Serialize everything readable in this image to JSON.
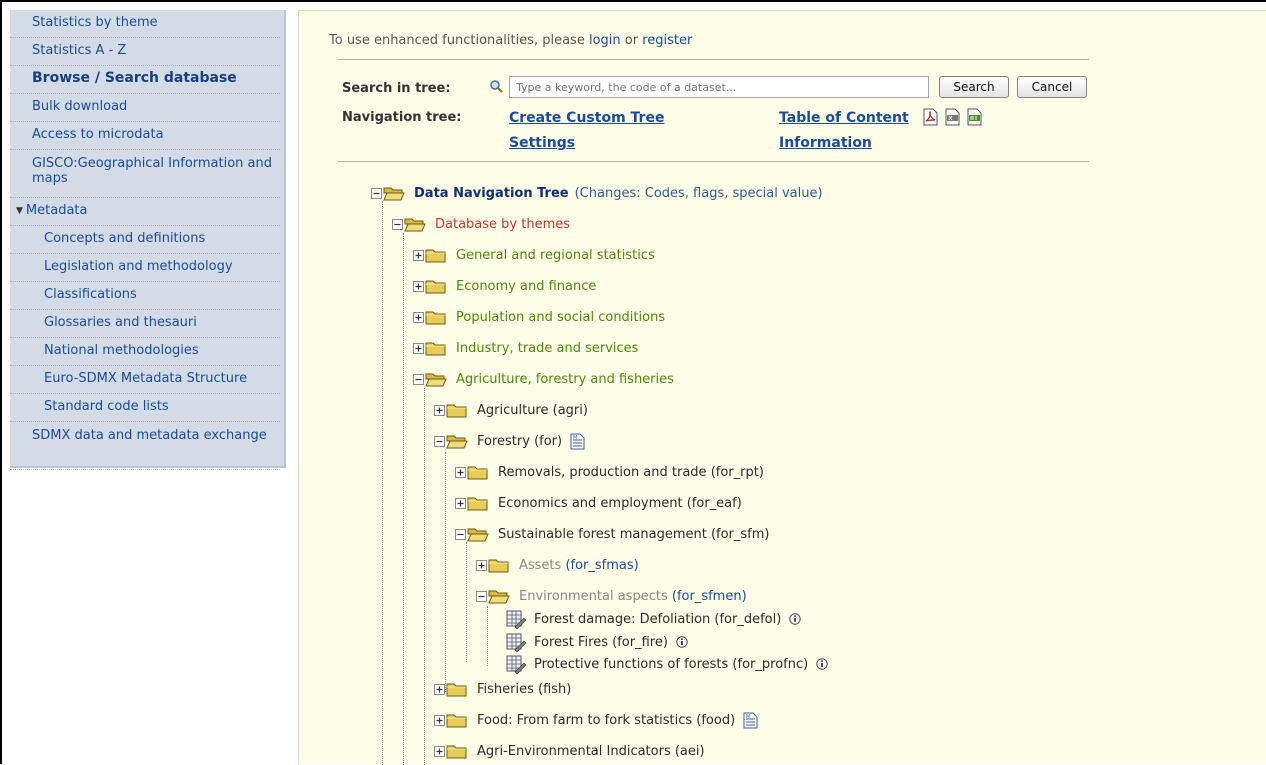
{
  "sidebar": {
    "items": [
      {
        "label": "Statistics by theme"
      },
      {
        "label": "Statistics A - Z"
      },
      {
        "label": "Browse / Search database"
      },
      {
        "label": "Bulk download"
      },
      {
        "label": "Access to microdata"
      },
      {
        "label": "GISCO:Geographical Information and maps"
      },
      {
        "label": "Metadata"
      },
      {
        "label": "Concepts and definitions"
      },
      {
        "label": "Legislation and methodology"
      },
      {
        "label": "Classifications"
      },
      {
        "label": "Glossaries and thesauri"
      },
      {
        "label": "National methodologies"
      },
      {
        "label": "Euro-SDMX Metadata Structure"
      },
      {
        "label": "Standard code lists"
      },
      {
        "label": "SDMX data and metadata exchange"
      }
    ]
  },
  "notice": {
    "prefix": "To use enhanced functionalities, please ",
    "login": "login",
    "middle": " or ",
    "register": "register"
  },
  "search": {
    "label": "Search in tree:",
    "placeholder": "Type a keyword, the code of a dataset...",
    "search_button": "Search",
    "cancel_button": "Cancel"
  },
  "navigation": {
    "label": "Navigation tree:",
    "create_custom_tree": "Create Custom Tree",
    "settings": "Settings",
    "table_of_content": "Table of Content",
    "information": "Information"
  },
  "export_icons": [
    "pdf-icon",
    "xls-icon",
    "xml-icon"
  ],
  "tree": {
    "root": {
      "title": "Data Navigation Tree",
      "note": "(Changes: Codes, flags, special value)"
    },
    "database_by_themes": "Database by themes",
    "themes": [
      "General and regional statistics",
      "Economy and finance",
      "Population and social conditions",
      "Industry, trade and services",
      "Agriculture, forestry and fisheries"
    ],
    "agri_children": [
      "Agriculture (agri)",
      "Forestry (for)",
      "Fisheries (fish)",
      "Food: From farm to fork statistics (food)",
      "Agri-Environmental Indicators (aei)"
    ],
    "forestry_children": [
      "Removals, production and trade (for_rpt)",
      "Economics and employment (for_eaf)",
      "Sustainable forest management (for_sfm)"
    ],
    "sfm_children": [
      {
        "name": "Assets",
        "code": "(for_sfmas)"
      },
      {
        "name": "Environmental aspects",
        "code": "(for_sfmen)"
      }
    ],
    "datasets": [
      "Forest damage: Defoliation (for_defol)",
      "Forest Fires (for_fire)",
      "Protective functions of forests (for_profnc)"
    ]
  }
}
